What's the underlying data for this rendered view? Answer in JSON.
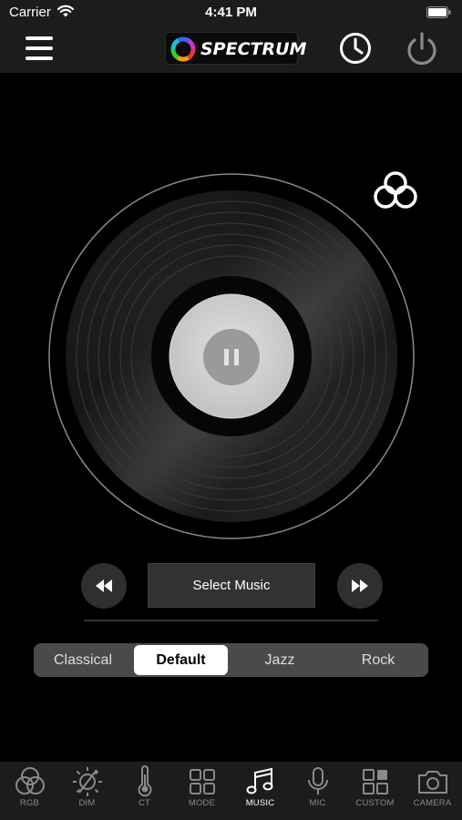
{
  "status_bar": {
    "carrier": "Carrier",
    "time": "4:41 PM"
  },
  "nav": {
    "logo_text": "SPECTRUM",
    "menu_icon": "hamburger-menu-icon",
    "timer_icon": "clock-icon",
    "power_icon": "power-icon"
  },
  "player": {
    "color_mode_icon": "three-circles-icon",
    "state": "playing",
    "pause_icon": "pause-icon",
    "select_music_label": "Select Music",
    "prev_icon": "rewind-icon",
    "next_icon": "fast-forward-icon"
  },
  "genres": {
    "options": [
      "Classical",
      "Default",
      "Jazz",
      "Rock"
    ],
    "selected": "Default"
  },
  "tabs": [
    {
      "label": "RGB",
      "icon": "rgb-circles-icon"
    },
    {
      "label": "DIM",
      "icon": "dim-sun-icon"
    },
    {
      "label": "CT",
      "icon": "thermometer-icon"
    },
    {
      "label": "MODE",
      "icon": "mode-grid-icon"
    },
    {
      "label": "MUSIC",
      "icon": "music-note-icon"
    },
    {
      "label": "MIC",
      "icon": "microphone-icon"
    },
    {
      "label": "CUSTOM",
      "icon": "custom-grid-icon"
    },
    {
      "label": "CAMERA",
      "icon": "camera-icon"
    }
  ],
  "active_tab": "MUSIC",
  "colors": {
    "background": "#000000",
    "bar": "#1c1c1c",
    "segment_bg": "#4a4a4a",
    "segment_active": "#ffffff",
    "tab_inactive": "#8a8a8a"
  }
}
